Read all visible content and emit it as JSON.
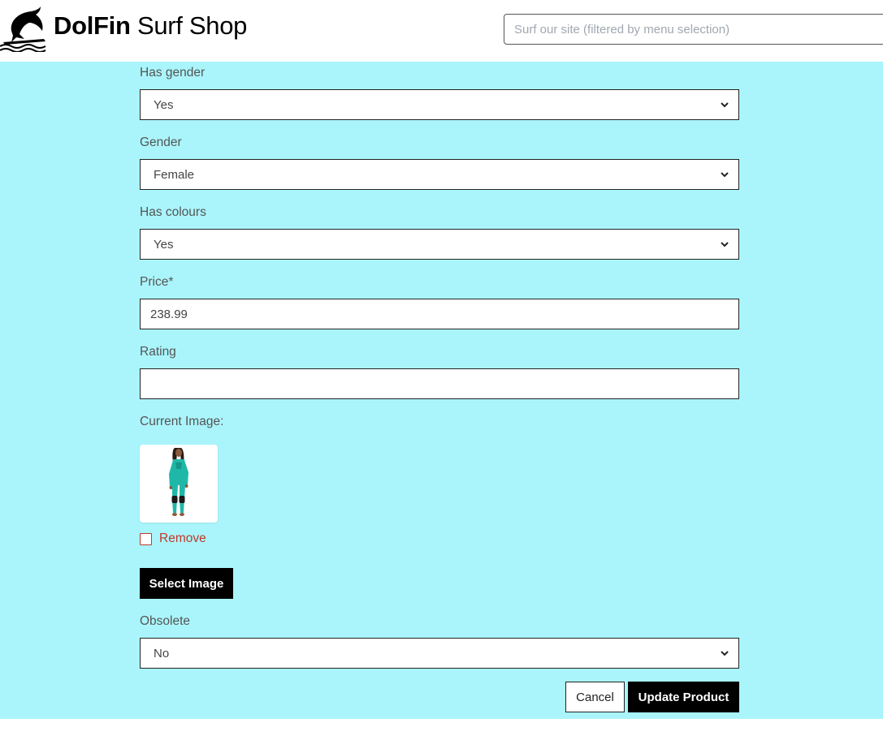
{
  "header": {
    "brand_bold": "DolFin",
    "brand_rest": "Surf Shop",
    "search_placeholder": "Surf our site (filtered by menu selection)"
  },
  "form": {
    "has_gender": {
      "label": "Has gender",
      "value": "Yes"
    },
    "gender": {
      "label": "Gender",
      "value": "Female"
    },
    "has_colours": {
      "label": "Has colours",
      "value": "Yes"
    },
    "price": {
      "label": "Price*",
      "value": "238.99"
    },
    "rating": {
      "label": "Rating",
      "value": ""
    },
    "current_image": {
      "label": "Current Image:",
      "remove_label": "Remove"
    },
    "select_image_label": "Select Image",
    "obsolete": {
      "label": "Obsolete",
      "value": "No"
    },
    "cancel_label": "Cancel",
    "update_label": "Update Product"
  },
  "colors": {
    "main_bg": "#aaf5fb",
    "button_black": "#000000",
    "remove_red": "#c0392b",
    "wetsuit_teal": "#1fb8a8"
  },
  "icons": {
    "logo": "dolphin-surfboard-icon",
    "select_chevron": "chevron-down-icon"
  }
}
